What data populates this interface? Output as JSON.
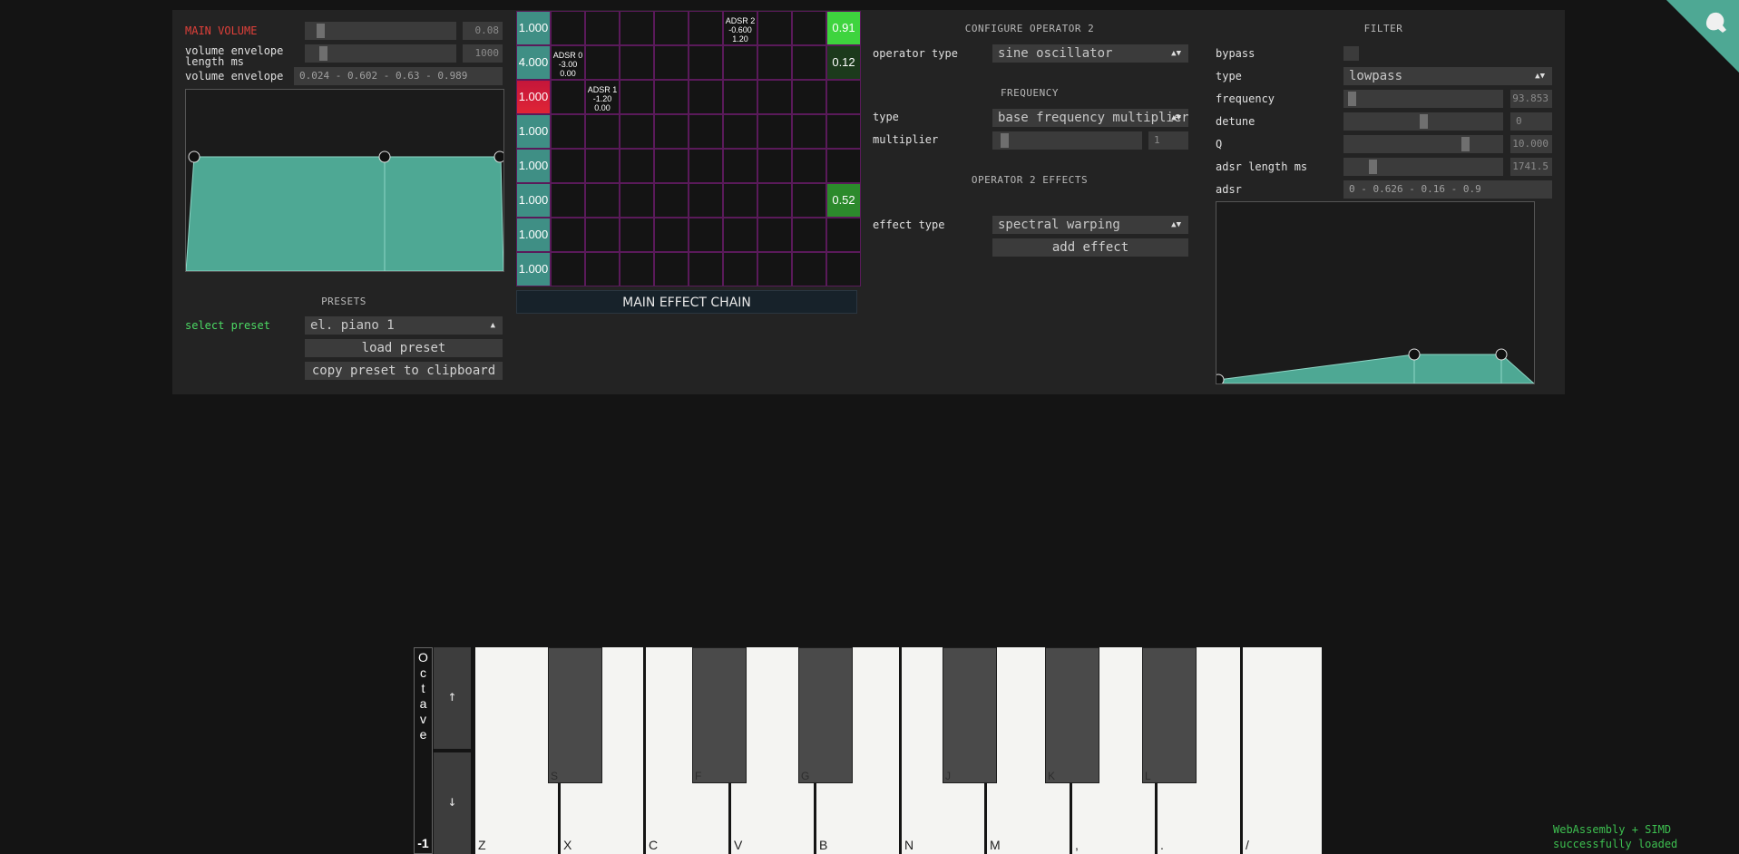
{
  "volume": {
    "main_label": "MAIN VOLUME",
    "main_value": "0.08",
    "main_level": 0.08,
    "env_len_label_1": "volume envelope",
    "env_len_label_2": "length ms",
    "env_len_value": "1000",
    "env_len_level": 0.1,
    "env_label": "volume envelope",
    "env_value": "0.024 - 0.602 - 0.63 - 0.989"
  },
  "presets": {
    "header": "PRESETS",
    "select_label": "select preset",
    "selected": "el. piano 1",
    "load_button": "load preset",
    "copy_button": "copy preset to clipboard"
  },
  "matrix": {
    "gains": [
      "1.000",
      "4.000",
      "1.000",
      "1.000",
      "1.000",
      "1.000",
      "1.000",
      "1.000"
    ],
    "outputs": [
      "0.91",
      "0.12",
      "",
      "",
      "",
      "0.52",
      "",
      ""
    ],
    "adsr_cells": [
      {
        "row": 1,
        "col": 1,
        "l1": "ADSR 0",
        "l2": "-3.00",
        "l3": "0.00"
      },
      {
        "row": 2,
        "col": 2,
        "l1": "ADSR 1",
        "l2": "-1.20",
        "l3": "0.00"
      },
      {
        "row": 0,
        "col": 6,
        "l1": "ADSR 2",
        "l2": "-0.600",
        "l3": "1.20"
      }
    ],
    "chain_label": "MAIN EFFECT CHAIN"
  },
  "operator": {
    "header": "CONFIGURE OPERATOR 2",
    "type_label": "operator type",
    "type_value": "sine oscillator",
    "freq_header": "FREQUENCY",
    "freq_type_label": "type",
    "freq_type_value": "base frequency multiplier",
    "multiplier_label": "multiplier",
    "multiplier_value": "1",
    "multiplier_level": 0.06,
    "effects_header": "OPERATOR 2 EFFECTS",
    "effect_type_label": "effect type",
    "effect_type_value": "spectral warping",
    "add_effect": "add effect"
  },
  "filter": {
    "header": "FILTER",
    "bypass_label": "bypass",
    "type_label": "type",
    "type_value": "lowpass",
    "frequency_label": "frequency",
    "frequency_value": "93.853",
    "frequency_level": 0.03,
    "detune_label": "detune",
    "detune_value": "0",
    "detune_level": 0.5,
    "q_label": "Q",
    "q_value": "10.000",
    "q_level": 0.78,
    "adsr_len_label": "adsr length ms",
    "adsr_len_value": "1741.5",
    "adsr_len_level": 0.17,
    "adsr_label": "adsr",
    "adsr_value": "0 - 0.626 - 0.16 - 0.9"
  },
  "keyboard": {
    "octave_letters": [
      "O",
      "c",
      "t",
      "a",
      "v",
      "e"
    ],
    "octave_value": "-1",
    "up_arrow": "↑",
    "down_arrow": "↓",
    "white_keys": [
      "Z",
      "X",
      "C",
      "V",
      "B",
      "N",
      "M",
      ",",
      ".",
      "/"
    ],
    "black_keys": [
      "S",
      "F",
      "G",
      "J",
      "K",
      "L"
    ]
  },
  "status": {
    "line1": "WebAssembly + SIMD",
    "line2": "successfully loaded"
  },
  "colors": {
    "accent_teal": "#4ea894",
    "panel": "#232323",
    "background": "#141414",
    "output_bright": "#3ed43e",
    "output_dim": "#2c8a2c",
    "gain_red": "#e02436",
    "status_green": "#3dbf50"
  }
}
